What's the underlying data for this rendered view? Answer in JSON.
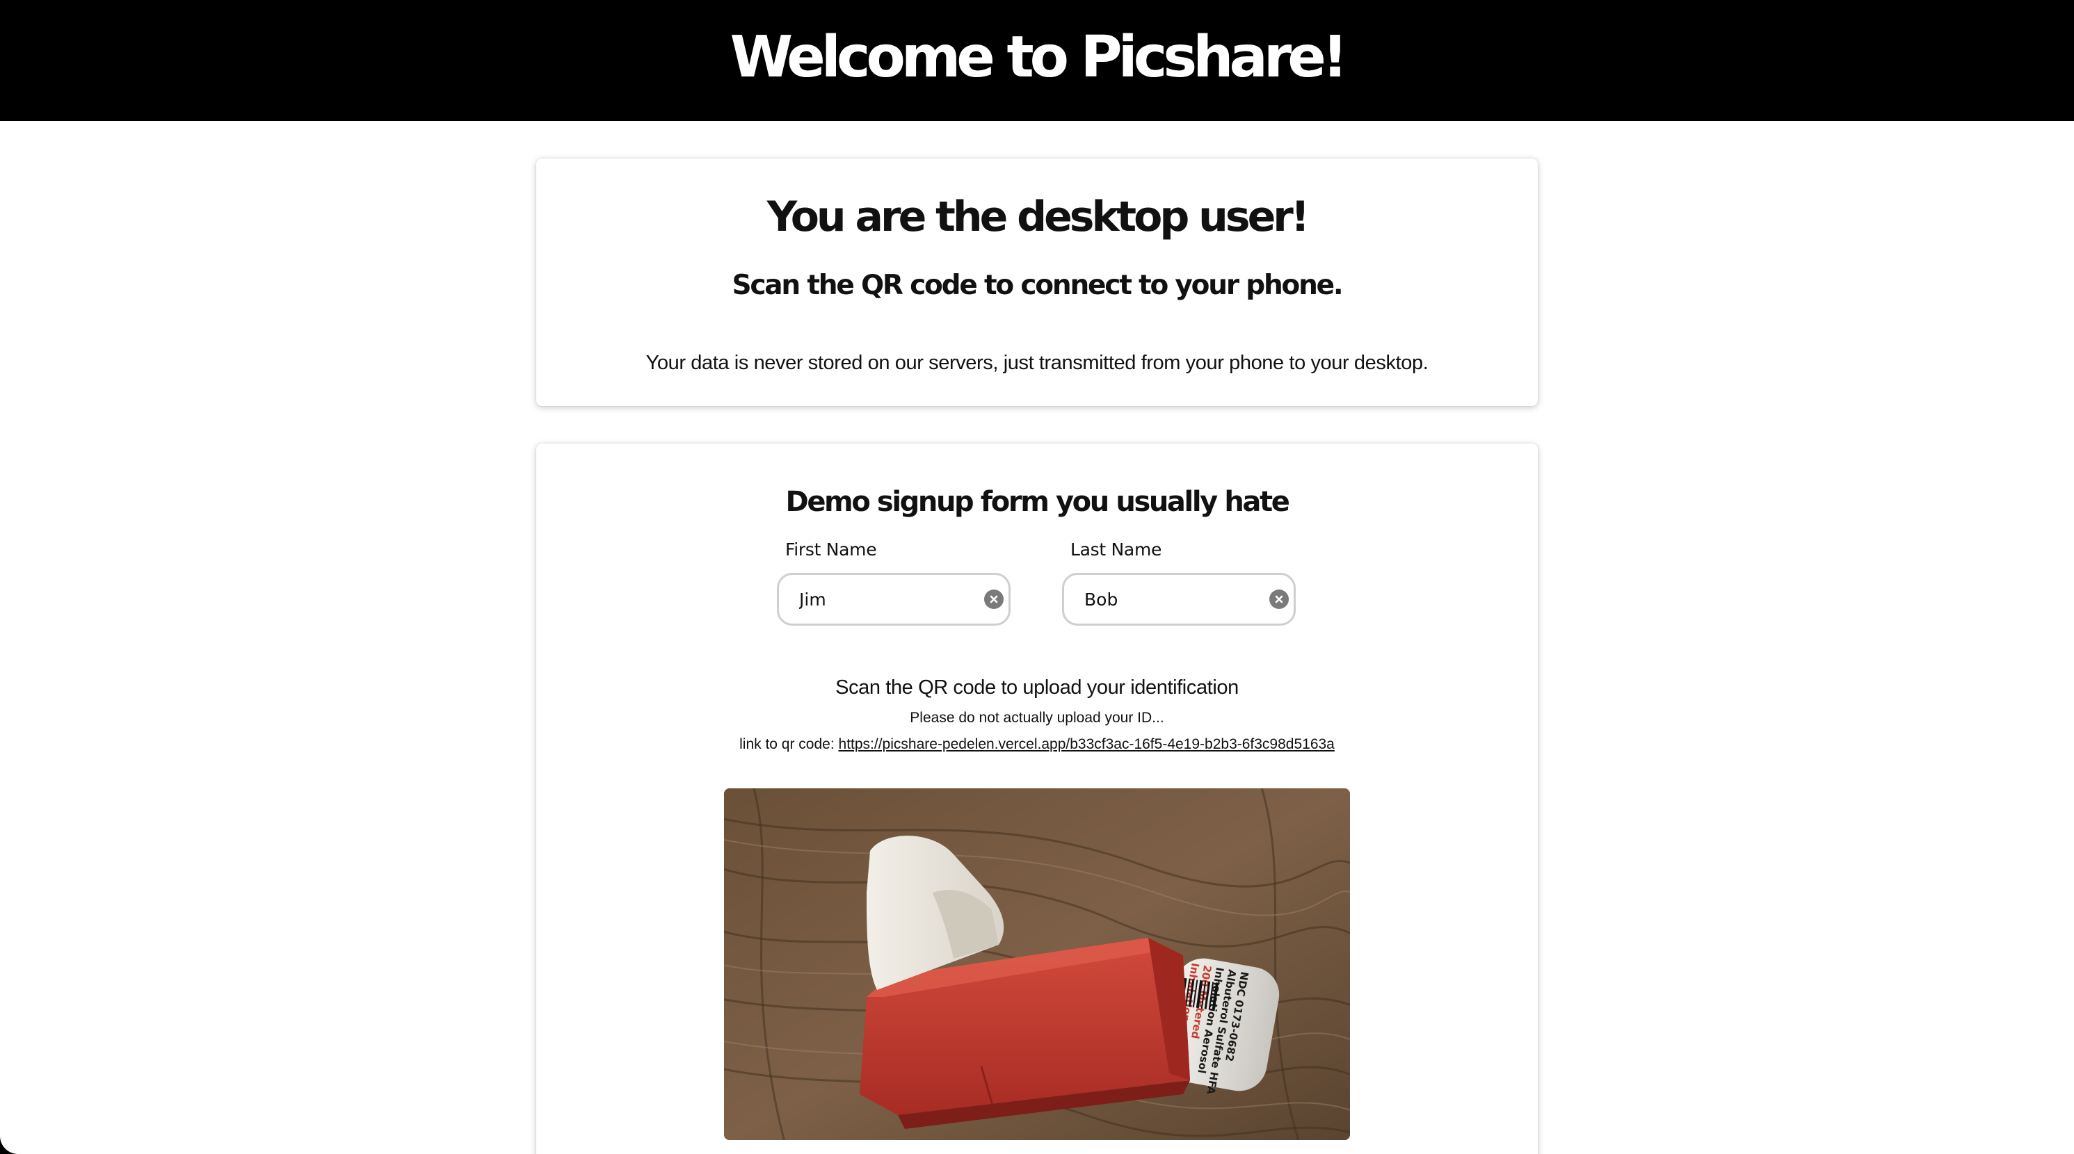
{
  "header": {
    "title": "Welcome to Picshare!"
  },
  "intro_card": {
    "heading": "You are the desktop user!",
    "subheading": "Scan the QR code to connect to your phone.",
    "note": "Your data is never stored on our servers, just transmitted from your phone to your desktop."
  },
  "signup_form": {
    "heading": "Demo signup form you usually hate",
    "first_name": {
      "label": "First Name",
      "value": "Jim"
    },
    "last_name": {
      "label": "Last Name",
      "value": "Bob"
    },
    "upload": {
      "title": "Scan the QR code to upload your identification",
      "warning": "Please do not actually upload your ID...",
      "link_prefix": "link to qr code:",
      "link_url": "https://picshare-pedelen.vercel.app/b33cf3ac-16f5-4e19-b2b3-6f3c98d5163a"
    },
    "uploaded_image": {
      "label_lines": [
        "NDC 0173-0682",
        "Albuterol Sulfate HFA",
        "Inhalation Aerosol",
        "200 Metered",
        "Inhalations"
      ]
    }
  },
  "colors": {
    "header_bg": "#000000",
    "header_text": "#ffffff",
    "page_bg": "#ffffff",
    "text": "#111111",
    "input_border": "#cfcfcf",
    "clear_button": "#7a7a7a",
    "inhaler_red": "#c73a30",
    "inhaler_cap": "#e8e4dc"
  },
  "icons": {
    "clear_input": "clear-circle-icon"
  }
}
